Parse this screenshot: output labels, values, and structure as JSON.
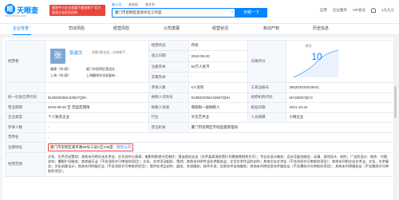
{
  "header": {
    "logo_text": "天眼查",
    "logo_sub": "TianYanCha.com",
    "promo": "国家中小企业发展子基金旗下 官方备案企业征信机构",
    "search_tabs": [
      "查公司",
      "查老板",
      "查关系"
    ],
    "search_value": "厦门市思明区宽语文化工作室",
    "search_button": "天眼一下",
    "nav": [
      "应用",
      "企业服务",
      "VIP会员",
      "1九九三"
    ]
  },
  "tabs": [
    {
      "label": "企业背景",
      "count": "7"
    },
    {
      "label": "司法风险",
      "count": ""
    },
    {
      "label": "经营风险",
      "count": ""
    },
    {
      "label": "公司发展",
      "count": ""
    },
    {
      "label": "经营状况",
      "count": ""
    },
    {
      "label": "知识产权",
      "count": ""
    },
    {
      "label": "历史信息",
      "count": ""
    }
  ],
  "info": {
    "legal_label": "经营者",
    "legal_avatar": "张",
    "legal_name": "张滋文",
    "legal_meta": "任职1家企业，分布如下",
    "legal_regions": [
      "福建（共1家）",
      "厦门市思明区宽语文...",
      "上海（共1家）",
      "上海翻译文化发展有..."
    ],
    "status_label": "经营状态",
    "status_value": "存续",
    "score_label": "天眼评分",
    "score_title": "评分",
    "score_value": "10",
    "est_label": "成立日期",
    "est_value": "2019-08-20",
    "capital_label": "注册资本",
    "capital_value": "50万人民币",
    "paid_label": "实缴资本",
    "paid_value": "-",
    "staff_label": "参保人数",
    "staff_value": "0人资料",
    "reg_no_label": "工商注册号",
    "reg_no_value": "350203310019041",
    "credit_label": "统一社会信用代码",
    "credit_value": "91350203MA33557Q0H",
    "tax_label": "纳税人识别号",
    "tax_value": "91350203MA33557Q0H",
    "org_label": "组织机构代码",
    "org_value": "MA33557Q0-0",
    "term_label": "营业期限",
    "term_value": "2019-08-20 至 无固定期限",
    "taxpayer_label": "纳税人资质",
    "taxpayer_value": "增值税一般纳税人",
    "approve_label": "核准日期",
    "approve_value": "2021-10-22",
    "type_label": "企业类型",
    "type_value": "个人独资企业",
    "industry_label": "行业",
    "industry_value": "文化艺术业",
    "size_label": "人员规模",
    "size_value": "小微企业",
    "insured_label": "参保人数",
    "insured_value": "-",
    "authority_label": "登记机关",
    "authority_value": "厦门市思明区市场监督管理局",
    "used_name_label": "曾用名",
    "used_name_value": "-",
    "address_label": "注册地址",
    "address_value": "厦门市思明区嘉禾路69号三层C区108室",
    "address_link": "附近公司",
    "scope_label": "经营范围",
    "scope_value": "文化、艺术活动策划；其他未列明文化艺术业；文艺创作与表演；电影和影视节目制作；演出经纪业务（艺术类表演经营行为需取得相关许可）；专业化设计服务；会议及展览服务；动漫、游戏设计、制作；广告的设计、制作、代理、发布；摄影扩印服务；其他娱乐业（不含须经许可审批的项目）；文化、艺术活动组织、策划；其他未列明专业技术服务业；文学艺术作品的创作；其他文化艺术业（不含须经许可审批的项目）；其他未列明文化艺术业；文化、艺术服务；文化创意设计；其他未列明娱乐业（不含须经许可审批的项目）；提供艺术品创作、展览、交流服务；软件开发；信息技术咨询服务；其他未列明信息技术服务业（不含需经许可审批的项目）；其他未列明服务业（不含需经许可审批的项目）。"
  },
  "colors": {
    "accent": "#0084ff",
    "highlight": "#e8463a"
  }
}
